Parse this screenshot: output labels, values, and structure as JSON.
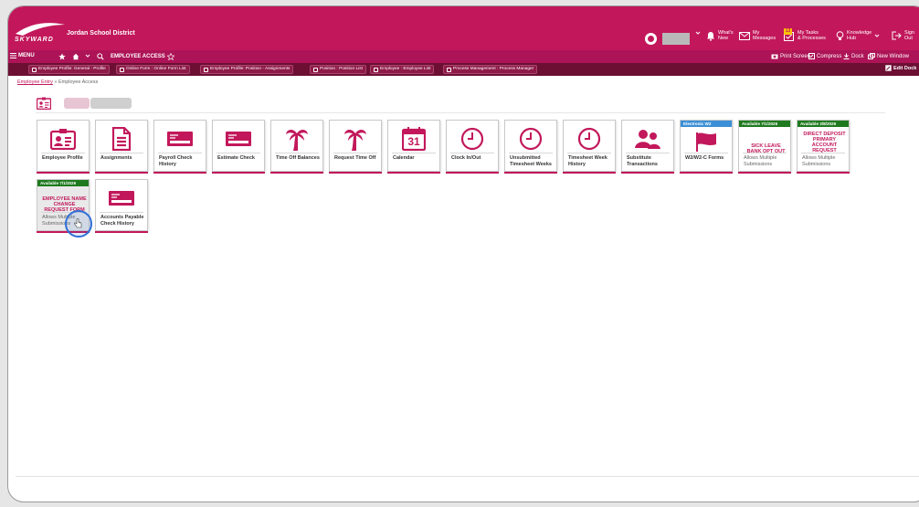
{
  "app": {
    "brand": "SKYWARD",
    "district": "Jordan School District"
  },
  "topnav": {
    "whats_new": [
      "What's",
      "New"
    ],
    "my_messages": [
      "My",
      "Messages"
    ],
    "my_tasks": [
      "My Tasks",
      "& Processes"
    ],
    "tasks_count": "13",
    "knowledge_hub": [
      "Knowledge",
      "Hub"
    ],
    "sign_out": [
      "Sign",
      "Out"
    ]
  },
  "menubar": {
    "menu": "MENU",
    "title": "EMPLOYEE ACCESS",
    "print_screen": "Print Screen",
    "compress": "Compress",
    "dock": "Dock",
    "new_window": "New Window"
  },
  "tabs": [
    "Employee Profile: General - Profile",
    "Online Form : Online Form List",
    "Employee Profile: Position - Assignments",
    "Position : Position List",
    "Employee : Employee List",
    "Process Management : Process Manager"
  ],
  "edit_dock": "Edit Dock",
  "breadcrumb": {
    "link": "Employee Entry",
    "separator": "»",
    "current": "Employee Access"
  },
  "tiles_row1": [
    {
      "icon": "id-card-icon",
      "label": "Employee Profile"
    },
    {
      "icon": "document-icon",
      "label": "Assignments"
    },
    {
      "icon": "check-icon",
      "label": "Payroll Check History"
    },
    {
      "icon": "check-icon",
      "label": "Estimate Check"
    },
    {
      "icon": "palm-tree-icon",
      "label": "Time Off Balances"
    },
    {
      "icon": "palm-tree-icon",
      "label": "Request Time Off"
    },
    {
      "icon": "calendar-icon",
      "label": "Calendar",
      "day": "31"
    },
    {
      "icon": "clock-icon",
      "label": "Clock In/Out"
    },
    {
      "icon": "clock-icon",
      "label": "Unsubmitted Timesheet Weeks"
    },
    {
      "icon": "clock-icon",
      "label": "Timesheet Week History"
    },
    {
      "icon": "people-icon",
      "label": "Substitute Transactions"
    }
  ],
  "special_tiles": [
    {
      "caption": "Electronic W2",
      "caption_color": "#3b8fd6",
      "icon": "flag-icon",
      "label": "W2/W2-C Forms"
    },
    {
      "caption": "Available 7/1/2026",
      "caption_color": "#1f7a1f",
      "text": "SICK LEAVE BANK OPT OUT",
      "sub": "Allows Multiple Submissions"
    },
    {
      "caption": "Available 3/8/2026",
      "caption_color": "#1f7a1f",
      "text": "DIRECT DEPOSIT PRIMARY ACCOUNT REQUEST",
      "sub": "Allows Multiple Submissions"
    }
  ],
  "tiles_row2": [
    {
      "caption": "Available 7/1/2026",
      "caption_color": "#1f7a1f",
      "text": "EMPLOYEE NAME CHANGE REQUEST FORM",
      "sub": "Allows Multiple Submissions"
    },
    {
      "icon": "check-icon",
      "label": "Accounts Payable Check History"
    }
  ],
  "colors": {
    "brand": "#c2185b",
    "menubar": "#ad1457",
    "tabbar": "#6d0f33",
    "available": "#1f7a1f",
    "electronic": "#3b8fd6"
  }
}
